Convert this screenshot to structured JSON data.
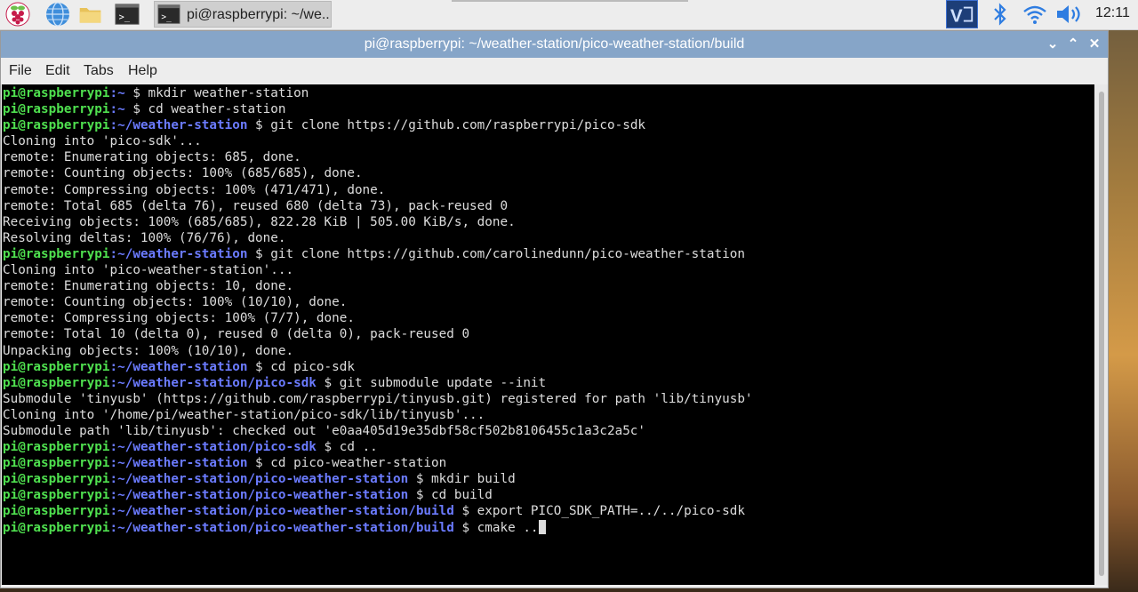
{
  "taskbar": {
    "task_title": "pi@raspberrypi: ~/we...",
    "clock": "12:11",
    "icons": [
      "raspberry-pi-menu-icon",
      "web-browser-icon",
      "file-manager-icon",
      "terminal-icon",
      "vnc-icon",
      "bluetooth-icon",
      "wifi-icon",
      "volume-icon"
    ]
  },
  "window": {
    "title": "pi@raspberrypi: ~/weather-station/pico-weather-station/build",
    "controls": {
      "minimize": "⌄",
      "maximize": "⌃",
      "close": "✕"
    },
    "menu": [
      "File",
      "Edit",
      "Tabs",
      "Help"
    ]
  },
  "terminal": {
    "lines": [
      {
        "u": "pi@raspberrypi",
        "p": ":~",
        "t": " $ mkdir weather-station"
      },
      {
        "u": "pi@raspberrypi",
        "p": ":~",
        "t": " $ cd weather-station"
      },
      {
        "u": "pi@raspberrypi",
        "p": ":~/weather-station",
        "t": " $ git clone https://github.com/raspberrypi/pico-sdk"
      },
      {
        "t": "Cloning into 'pico-sdk'..."
      },
      {
        "t": "remote: Enumerating objects: 685, done."
      },
      {
        "t": "remote: Counting objects: 100% (685/685), done."
      },
      {
        "t": "remote: Compressing objects: 100% (471/471), done."
      },
      {
        "t": "remote: Total 685 (delta 76), reused 680 (delta 73), pack-reused 0"
      },
      {
        "t": "Receiving objects: 100% (685/685), 822.28 KiB | 505.00 KiB/s, done."
      },
      {
        "t": "Resolving deltas: 100% (76/76), done."
      },
      {
        "u": "pi@raspberrypi",
        "p": ":~/weather-station",
        "t": " $ git clone https://github.com/carolinedunn/pico-weather-station"
      },
      {
        "t": "Cloning into 'pico-weather-station'..."
      },
      {
        "t": "remote: Enumerating objects: 10, done."
      },
      {
        "t": "remote: Counting objects: 100% (10/10), done."
      },
      {
        "t": "remote: Compressing objects: 100% (7/7), done."
      },
      {
        "t": "remote: Total 10 (delta 0), reused 0 (delta 0), pack-reused 0"
      },
      {
        "t": "Unpacking objects: 100% (10/10), done."
      },
      {
        "u": "pi@raspberrypi",
        "p": ":~/weather-station",
        "t": " $ cd pico-sdk"
      },
      {
        "u": "pi@raspberrypi",
        "p": ":~/weather-station/pico-sdk",
        "t": " $ git submodule update --init"
      },
      {
        "t": "Submodule 'tinyusb' (https://github.com/raspberrypi/tinyusb.git) registered for path 'lib/tinyusb'"
      },
      {
        "t": "Cloning into '/home/pi/weather-station/pico-sdk/lib/tinyusb'..."
      },
      {
        "t": "Submodule path 'lib/tinyusb': checked out 'e0aa405d19e35dbf58cf502b8106455c1a3c2a5c'"
      },
      {
        "u": "pi@raspberrypi",
        "p": ":~/weather-station/pico-sdk",
        "t": " $ cd .."
      },
      {
        "u": "pi@raspberrypi",
        "p": ":~/weather-station",
        "t": " $ cd pico-weather-station"
      },
      {
        "u": "pi@raspberrypi",
        "p": ":~/weather-station/pico-weather-station",
        "t": " $ mkdir build"
      },
      {
        "u": "pi@raspberrypi",
        "p": ":~/weather-station/pico-weather-station",
        "t": " $ cd build"
      },
      {
        "u": "pi@raspberrypi",
        "p": ":~/weather-station/pico-weather-station/build",
        "t": " $ export PICO_SDK_PATH=../../pico-sdk"
      },
      {
        "u": "pi@raspberrypi",
        "p": ":~/weather-station/pico-weather-station/build",
        "t": " $ cmake ..",
        "cursor": true
      }
    ]
  },
  "colors": {
    "user_host": "#4fe04f",
    "path": "#6b7bff",
    "text": "#dddddd",
    "titlebar": "#86a5c8"
  }
}
